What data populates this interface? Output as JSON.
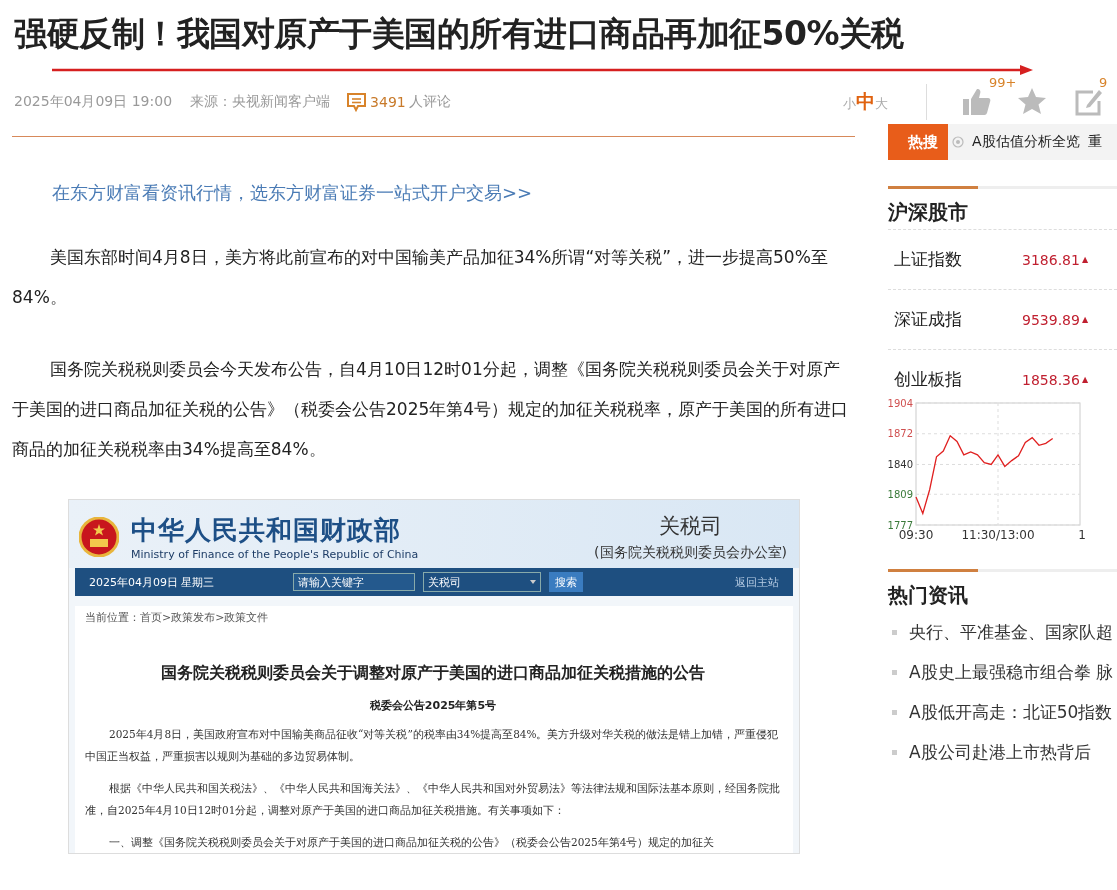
{
  "article": {
    "title": "强硬反制！我国对原产于美国的所有进口商品再加征50%关税",
    "date": "2025年04月09日 19:00",
    "source_label": "来源：",
    "source": "央视新闻客户端",
    "comment_count": "3491",
    "comment_label": "人评论"
  },
  "font_size_options": [
    {
      "label": "小",
      "selected": false
    },
    {
      "label": "中",
      "selected": true
    },
    {
      "label": "大",
      "selected": false
    }
  ],
  "actions": [
    {
      "kind": "like",
      "count": "99+"
    },
    {
      "kind": "favorite"
    },
    {
      "kind": "comment",
      "count": "9"
    }
  ],
  "promo_link": "在东方财富看资讯行情，选东方财富证券一站式开户交易>>",
  "paragraphs": [
    "美国东部时间4月8日，美方将此前宣布的对中国输美产品加征34%所谓“对等关税”，进一步提高50%至84%。",
    "国务院关税税则委员会今天发布公告，自4月10日12时01分起，调整《国务院关税税则委员会关于对原产于美国的进口商品加征关税的公告》（税委会公告2025年第4号）规定的加征关税税率，原产于美国的所有进口商品的加征关税税率由34%提高至84%。"
  ],
  "embedded_page": {
    "site_name": "中华人民共和国财政部",
    "site_name_en": "Ministry of Finance of the People's Republic of China",
    "department": "关税司",
    "department_note": "(国务院关税税则委员会办公室)",
    "nav": {
      "date": "2025年04月09日  星期三",
      "search_placeholder": "请输入关键字",
      "scope": "关税司",
      "search_button": "搜索",
      "home_link": "返回主站"
    },
    "breadcrumb": "当前位置：首页>政策发布>政策文件",
    "title": "国务院关税税则委员会关于调整对原产于美国的进口商品加征关税措施的公告",
    "subtitle": "税委会公告2025年第5号",
    "paragraphs": [
      "2025年4月8日，美国政府宣布对中国输美商品征收“对等关税”的税率由34%提高至84%。美方升级对华关税的做法是错上加错，严重侵犯中国正当权益，严重损害以规则为基础的多边贸易体制。",
      "根据《中华人民共和国关税法》、《中华人民共和国海关法》、《中华人民共和国对外贸易法》等法律法规和国际法基本原则，经国务院批准，自2025年4月10日12时01分起，调整对原产于美国的进口商品加征关税措施。有关事项如下：",
      "一、调整《国务院关税税则委员会关于对原产于美国的进口商品加征关税的公告》（税委会公告2025年第4号）规定的加征关"
    ]
  },
  "sidebar": {
    "hot_search": {
      "badge": "热搜",
      "items": [
        "A股估值分析全览",
        "重"
      ]
    },
    "market": {
      "title": "沪深股市",
      "indices": [
        {
          "name": "上证指数",
          "value": "3186.81",
          "arrow": "▲"
        },
        {
          "name": "深证成指",
          "value": "9539.89",
          "arrow": "▲"
        },
        {
          "name": "创业板指",
          "value": "1858.36",
          "arrow": "▲"
        }
      ],
      "chart_data": {
        "type": "line",
        "categories": [
          "09:30",
          null,
          null,
          null,
          null,
          null,
          null,
          null,
          null,
          null,
          null,
          null,
          "11:30/13:00",
          null,
          null,
          null,
          null,
          null,
          null,
          null,
          null,
          null,
          null,
          null,
          "1"
        ],
        "series": [
          {
            "color": "#e02020",
            "values": [
              1806,
              1789,
              1814,
              1848,
              1854,
              1870,
              1864,
              1850,
              1853,
              1850,
              1842,
              1840,
              1850,
              1838,
              1844,
              1849,
              1863,
              1868,
              1860,
              1862,
              1867,
              null,
              null,
              null,
              null
            ]
          }
        ],
        "ylim": [
          1777,
          1904
        ],
        "yticks": [
          1777,
          1809,
          1840,
          1872,
          1904
        ],
        "grid": true
      }
    },
    "news": {
      "title": "热门资讯",
      "items": [
        "央行、平准基金、国家队超",
        "A股史上最强稳市组合拳 脉",
        "A股低开高走：北证50指数",
        "A股公司赴港上市热背后"
      ]
    }
  }
}
